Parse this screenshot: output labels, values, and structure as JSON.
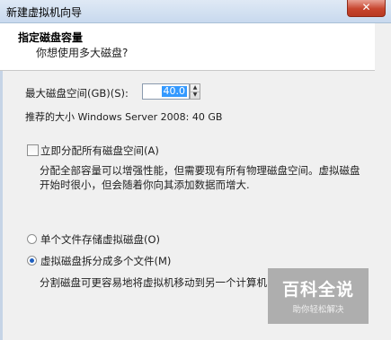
{
  "window": {
    "title": "新建虚拟机向导",
    "close_label": "✕"
  },
  "header": {
    "title": "指定磁盘容量",
    "subtitle": "你想使用多大磁盘?"
  },
  "disk_size": {
    "label": "最大磁盘空间(GB)(S):",
    "value": "40.0",
    "recommendation": "推荐的大小 Windows Server 2008: 40 GB"
  },
  "allocate": {
    "checkbox_label": "立即分配所有磁盘空间(A)",
    "checked": false,
    "description_line1": "分配全部容量可以增强性能，但需要现有所有物理磁盘空间。虚拟磁盘",
    "description_line2": "开始时很小，但会随着你向其添加数据而增大."
  },
  "storage_options": {
    "single_file_label": "单个文件存储虚拟磁盘(O)",
    "split_files_label": "虚拟磁盘拆分成多个文件(M)",
    "selected": "split_files",
    "split_description": "分割磁盘可更容易地将虚拟机移动到另一个计算机"
  },
  "watermark": {
    "title": "百科全说",
    "subtitle": "助你轻松解决"
  },
  "colors": {
    "selection": "#3399ff",
    "radio_dot": "#1f5fbf",
    "close_button": "#c7452e"
  }
}
